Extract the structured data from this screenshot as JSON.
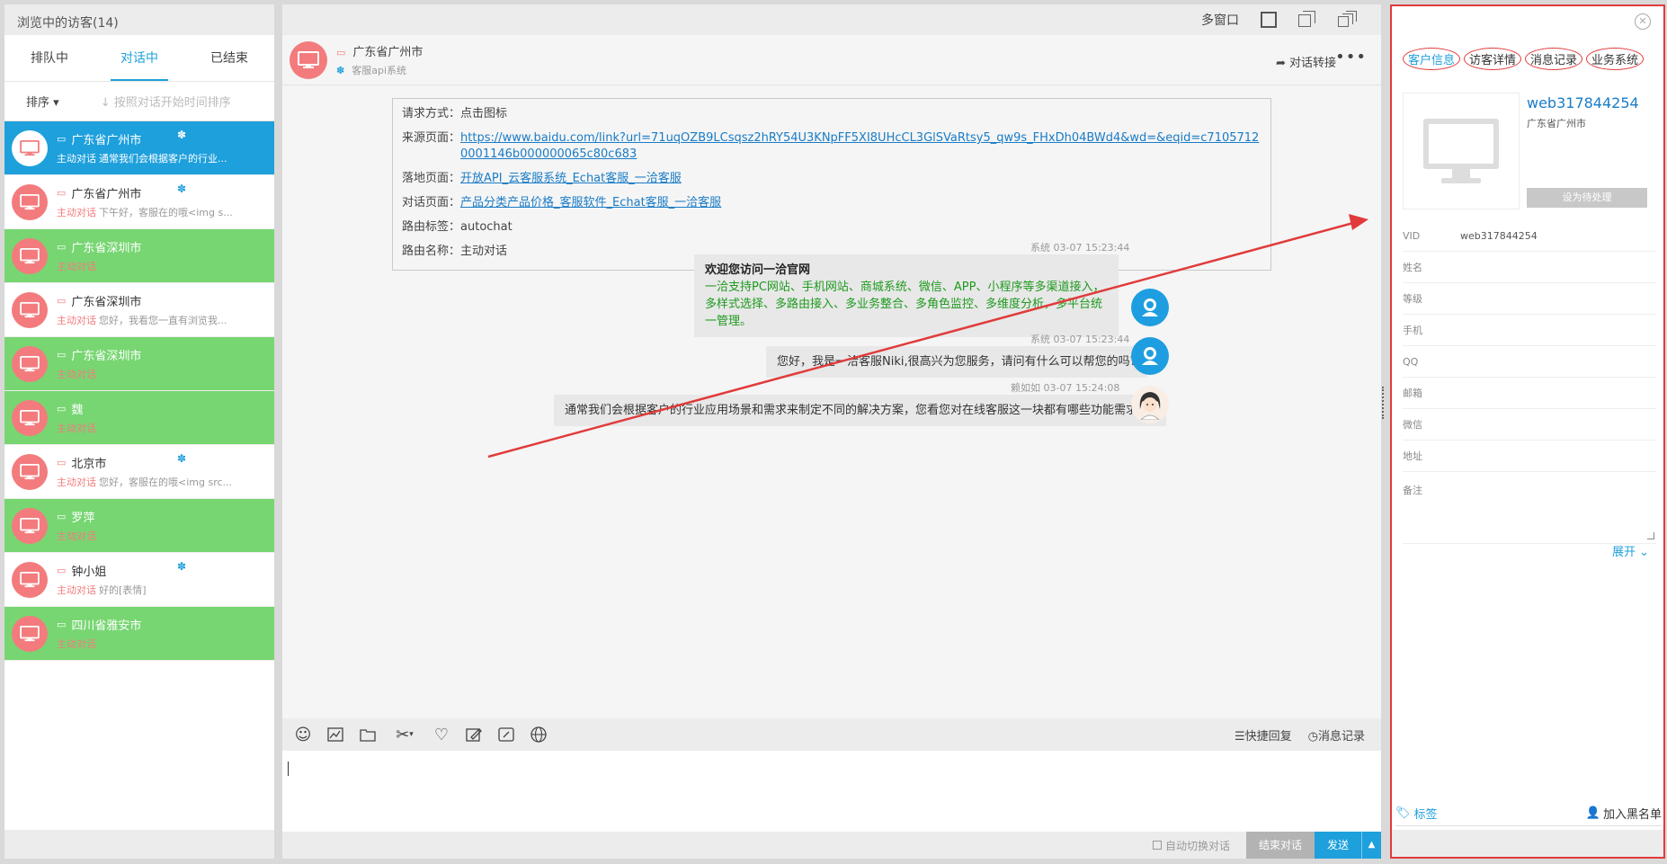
{
  "left": {
    "header": "浏览中的访客(14)",
    "tabs": [
      "排队中",
      "对话中",
      "已结束"
    ],
    "sort_label": "排序",
    "sort_hint": "按照对话开始时间排序",
    "visitors": [
      {
        "name": "广东省广州市",
        "status": "主动对话",
        "msg": "通常我们会根据客户的行业...",
        "style": "selected",
        "paw": true
      },
      {
        "name": "广东省广州市",
        "status": "主动对话",
        "msg": "下午好，客服在的哦<img s...",
        "style": "white",
        "paw": true
      },
      {
        "name": "广东省深圳市",
        "status": "主动对话",
        "msg": "",
        "style": "green",
        "paw": false
      },
      {
        "name": "广东省深圳市",
        "status": "主动对话",
        "msg": "您好，我看您一直有浏览我...",
        "style": "white",
        "paw": false
      },
      {
        "name": "广东省深圳市",
        "status": "主动对话",
        "msg": "",
        "style": "green",
        "paw": false
      },
      {
        "name": "魏",
        "status": "主动对话",
        "msg": "",
        "style": "green",
        "paw": false
      },
      {
        "name": "北京市",
        "status": "主动对话",
        "msg": "您好，客服在的哦<img src...",
        "style": "white",
        "paw": true
      },
      {
        "name": "罗萍",
        "status": "主动对话",
        "msg": "",
        "style": "green",
        "paw": false
      },
      {
        "name": "钟小姐",
        "status": "主动对话",
        "msg": "好的[表情]",
        "style": "white",
        "paw": true
      },
      {
        "name": "四川省雅安市",
        "status": "主动对话",
        "msg": "",
        "style": "green",
        "paw": false
      }
    ]
  },
  "center": {
    "multi_window": "多窗口",
    "chat_city": "广东省广州市",
    "chat_system": "客服api系统",
    "transfer": "对话转接",
    "info": [
      {
        "label": "请求方式：",
        "value": "点击图标",
        "link": false
      },
      {
        "label": "来源页面：",
        "value": "https://www.baidu.com/link?url=71uqOZB9LCsqsz2hRY54U3KNpFF5XI8UHcCL3GlSVaRtsy5_qw9s_FHxDh04BWd4&wd=&eqid=c71057120001146b000000065c80c683",
        "link": true
      },
      {
        "label": "落地页面：",
        "value": "开放API_云客服系统_Echat客服_一洽客服",
        "link": true
      },
      {
        "label": "对话页面：",
        "value": "产品分类产品价格_客服软件_Echat客服_一洽客服",
        "link": true
      },
      {
        "label": "路由标签：",
        "value": "autochat",
        "link": false
      },
      {
        "label": "路由名称：",
        "value": "主动对话",
        "link": false
      }
    ],
    "messages": {
      "m1_meta": "系统 03-07 15:23:44",
      "m1_title": "欢迎您访问一洽官网",
      "m1_line1": "一洽支持PC网站、手机网站、商城系统、微信、APP、小程序等多渠道接入，",
      "m1_line2": "多样式选择、多路由接入、多业务整合、多角色监控、多维度分析，多平台统一管理。",
      "m2_meta": "系统 03-07 15:23:44",
      "m2_text": "您好，我是一洽客服Niki,很高兴为您服务，请问有什么可以帮您的吗?",
      "m3_meta": "赖如如 03-07 15:24:08",
      "m3_text": "通常我们会根据客户的行业应用场景和需求来制定不同的解决方案，您看您对在线客服这一块都有哪些功能需求呢?"
    },
    "quick_reply": "快捷回复",
    "msg_log": "消息记录",
    "auto_switch": "自动切换对话",
    "end_chat": "结束对话",
    "send": "发送"
  },
  "right": {
    "tabs": [
      "客户信息",
      "访客详情",
      "消息记录",
      "业务系统"
    ],
    "visitor_id": "web317844254",
    "city": "广东省广州市",
    "pending_btn": "设为待处理",
    "fields": [
      {
        "label": "VID",
        "value": "web317844254"
      },
      {
        "label": "姓名",
        "value": ""
      },
      {
        "label": "等级",
        "value": ""
      },
      {
        "label": "手机",
        "value": ""
      },
      {
        "label": "QQ",
        "value": ""
      },
      {
        "label": "邮箱",
        "value": ""
      },
      {
        "label": "微信",
        "value": ""
      },
      {
        "label": "地址",
        "value": ""
      }
    ],
    "note_label": "备注",
    "expand": "展开",
    "tag": "标签",
    "blacklist": "加入黑名单"
  },
  "colors": {
    "accent": "#1ea0dc",
    "visitor_avatar": "#f37b7d",
    "green_row": "#77d672",
    "annotation_red": "#e13b3b"
  }
}
